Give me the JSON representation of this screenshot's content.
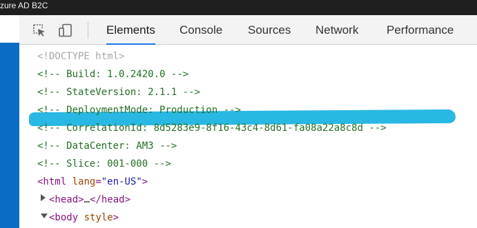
{
  "window": {
    "title": "zure AD B2C"
  },
  "toolbar": {
    "inspect_icon": "inspect-element-icon",
    "device_icon": "device-toolbar-icon",
    "tabs": [
      {
        "label": "Elements",
        "active": true
      },
      {
        "label": "Console",
        "active": false
      },
      {
        "label": "Sources",
        "active": false
      },
      {
        "label": "Network",
        "active": false
      },
      {
        "label": "Performance",
        "active": false
      }
    ]
  },
  "code": {
    "doctype": "<!DOCTYPE html>",
    "comments": [
      "<!-- Build: 1.0.2420.0 -->",
      "<!-- StateVersion: 2.1.1 -->",
      "<!-- DeploymentMode: Production -->",
      "<!-- CorrelationId: 8d5283e9-8f16-43c4-8d61-fa08a22a8c8d -->",
      "<!-- DataCenter: AM3 -->",
      "<!-- Slice: 001-000 -->"
    ],
    "html_tag": {
      "open": "<html",
      "attr_name": " lang",
      "eq": "=",
      "attr_value": "\"en-US\"",
      "close": ">"
    },
    "head_tag": {
      "open": "<head>",
      "ellipsis": "…",
      "close": "</head>"
    },
    "body_tag": {
      "open": "<body",
      "attr_name": " style",
      "close": ">"
    }
  },
  "colors": {
    "highlight": "#29b7e4",
    "tab_underline": "#1a73e8",
    "comment": "#236e25",
    "tag": "#881280"
  }
}
